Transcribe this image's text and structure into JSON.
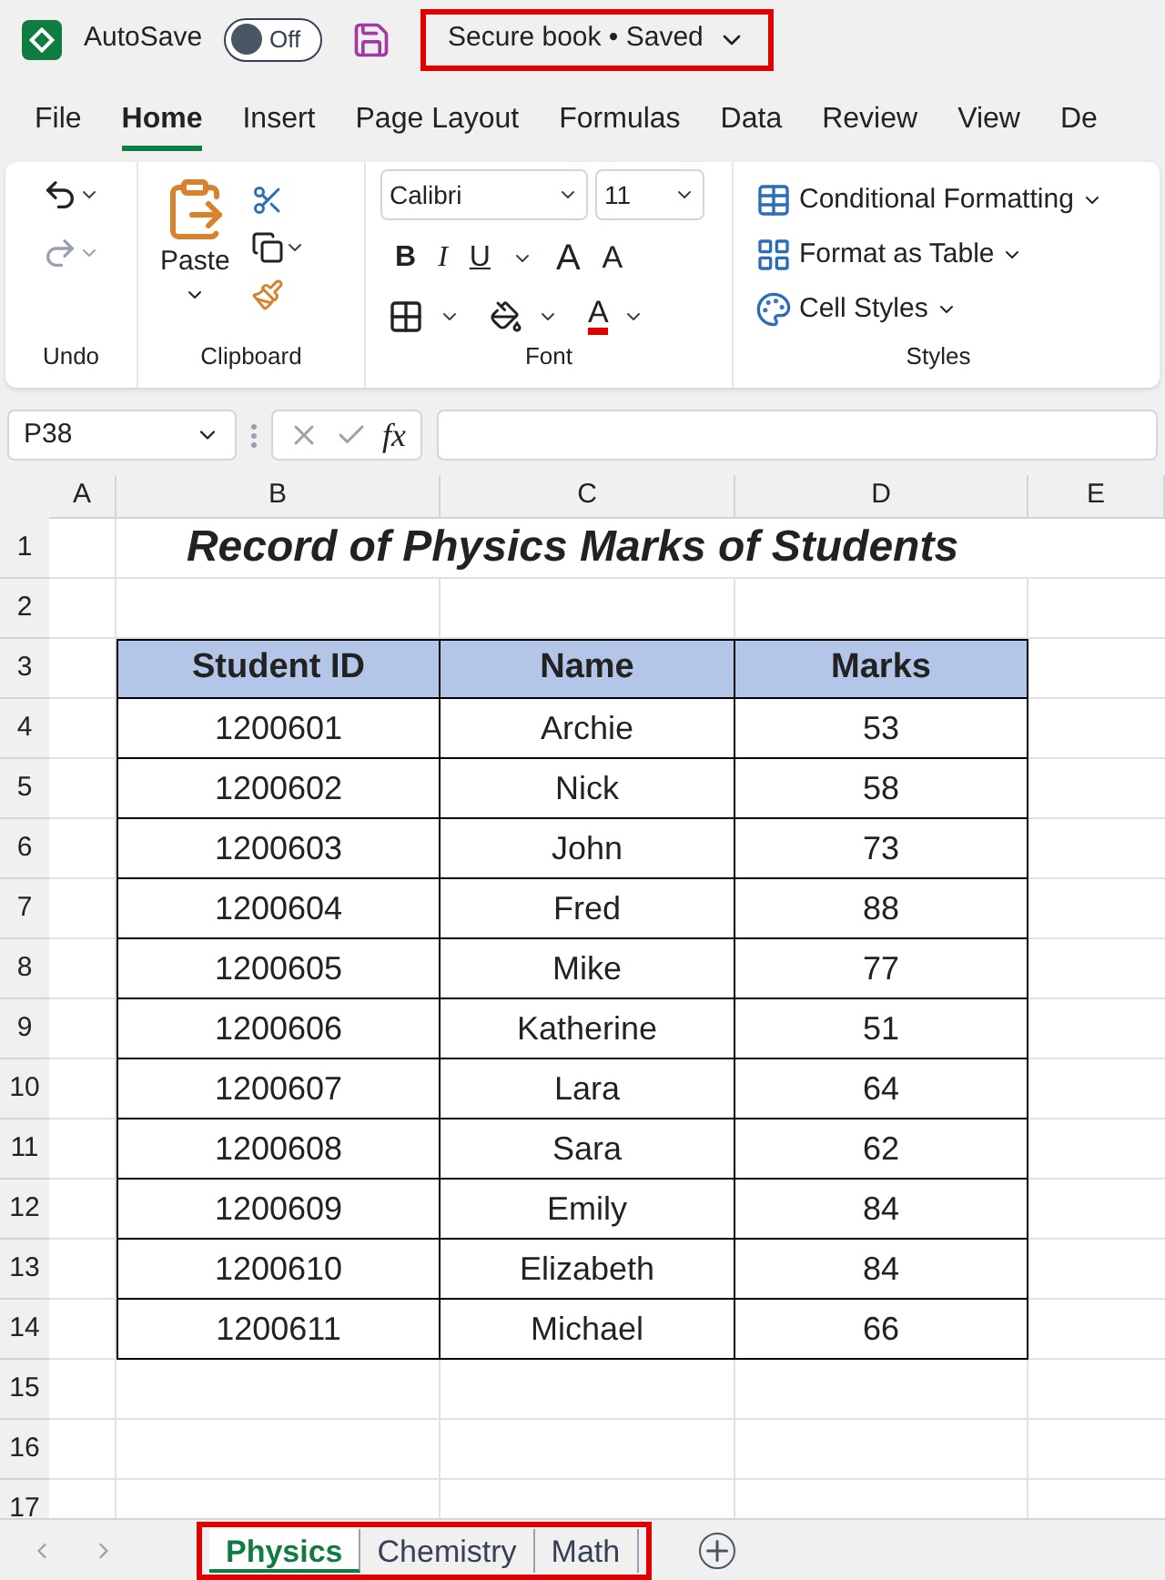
{
  "title_bar": {
    "autosave_label": "AutoSave",
    "autosave": {
      "on": false,
      "label": "Off"
    },
    "document_title": "Secure book • Saved"
  },
  "menu_tabs": [
    {
      "label": "File",
      "selected": false
    },
    {
      "label": "Home",
      "selected": true
    },
    {
      "label": "Insert",
      "selected": false
    },
    {
      "label": "Page Layout",
      "selected": false
    },
    {
      "label": "Formulas",
      "selected": false
    },
    {
      "label": "Data",
      "selected": false
    },
    {
      "label": "Review",
      "selected": false
    },
    {
      "label": "View",
      "selected": false
    },
    {
      "label": "De",
      "selected": false
    }
  ],
  "ribbon": {
    "undo_group": "Undo",
    "clipboard": {
      "paste": "Paste",
      "group": "Clipboard"
    },
    "font": {
      "font_name": "Calibri",
      "font_size": "11",
      "bold": "B",
      "italic": "I",
      "underline": "U",
      "grow": "A",
      "shrink": "A",
      "font_color": "A",
      "group": "Font"
    },
    "styles": {
      "items": [
        "Conditional Formatting",
        "Format as Table",
        "Cell Styles"
      ],
      "group": "Styles"
    }
  },
  "formula_bar": {
    "name_box": "P38",
    "fx": "fx"
  },
  "column_headers": [
    "A",
    "B",
    "C",
    "D",
    "E"
  ],
  "row_headers": [
    "1",
    "2",
    "3",
    "4",
    "5",
    "6",
    "7",
    "8",
    "9",
    "10",
    "11",
    "12",
    "13",
    "14",
    "15",
    "16",
    "17"
  ],
  "sheet_title": "Record of Physics Marks of Students",
  "table": {
    "columns": [
      "Student ID",
      "Name",
      "Marks"
    ],
    "rows": [
      [
        "1200601",
        "Archie",
        "53"
      ],
      [
        "1200602",
        "Nick",
        "58"
      ],
      [
        "1200603",
        "John",
        "73"
      ],
      [
        "1200604",
        "Fred",
        "88"
      ],
      [
        "1200605",
        "Mike",
        "77"
      ],
      [
        "1200606",
        "Katherine",
        "51"
      ],
      [
        "1200607",
        "Lara",
        "64"
      ],
      [
        "1200608",
        "Sara",
        "62"
      ],
      [
        "1200609",
        "Emily",
        "84"
      ],
      [
        "1200610",
        "Elizabeth",
        "84"
      ],
      [
        "1200611",
        "Michael",
        "66"
      ]
    ]
  },
  "sheet_tabs": [
    {
      "label": "Physics",
      "selected": true
    },
    {
      "label": "Chemistry",
      "selected": false
    },
    {
      "label": "Math",
      "selected": false
    }
  ]
}
